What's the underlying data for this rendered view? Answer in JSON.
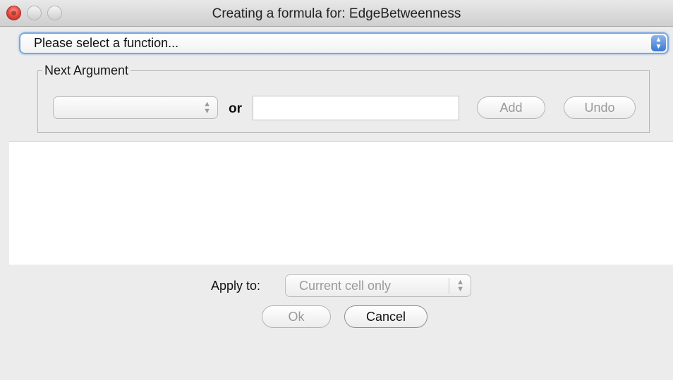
{
  "window": {
    "title": "Creating a formula for: EdgeBetweenness"
  },
  "function_select": {
    "value": "Please select a function..."
  },
  "next_argument": {
    "group_title": "Next Argument",
    "argument_select_value": "",
    "or_label": "or",
    "argument_input_value": "",
    "add_label": "Add",
    "undo_label": "Undo"
  },
  "formula_area": {
    "text": ""
  },
  "apply_to": {
    "label": "Apply to:",
    "value": "Current cell only"
  },
  "buttons": {
    "ok_label": "Ok",
    "cancel_label": "Cancel"
  },
  "icons": {
    "close": "close-icon",
    "minimize": "minimize-icon",
    "zoom": "zoom-icon",
    "stepper": "updown-stepper-icon"
  }
}
